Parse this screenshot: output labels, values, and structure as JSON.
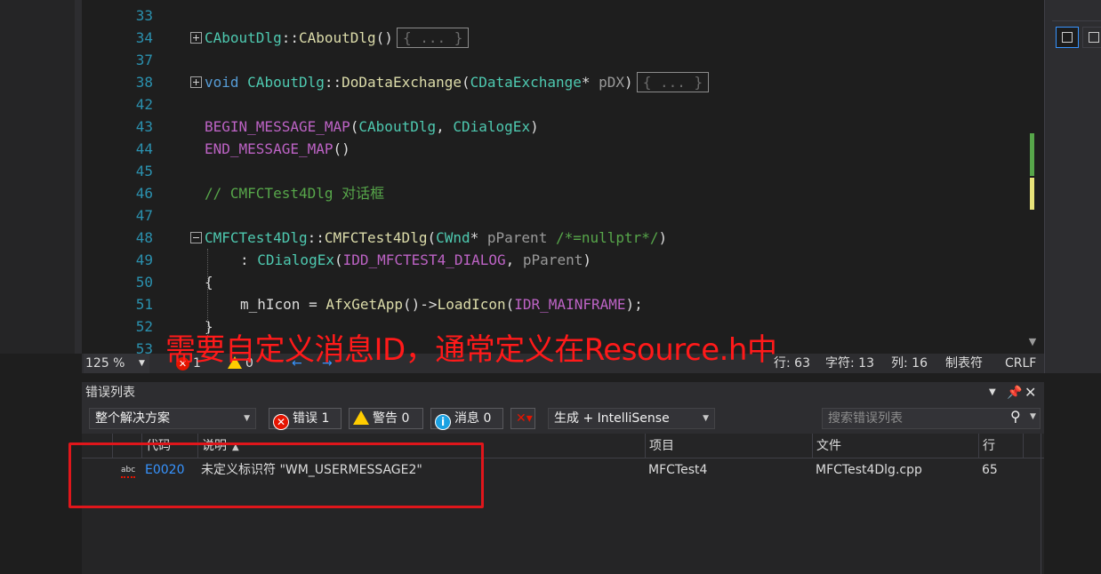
{
  "editor": {
    "lines": [
      {
        "n": "33"
      },
      {
        "n": "34",
        "fold": "plus",
        "parts": [
          [
            "ty",
            "CAboutDlg"
          ],
          [
            "pl",
            "::"
          ],
          [
            "fn",
            "CAboutDlg"
          ],
          [
            "pl",
            "()"
          ]
        ],
        "collapsed": "{ ... }"
      },
      {
        "n": "37"
      },
      {
        "n": "38",
        "fold": "plus",
        "parts": [
          [
            "kw",
            "void "
          ],
          [
            "ty",
            "CAboutDlg"
          ],
          [
            "pl",
            "::"
          ],
          [
            "fn",
            "DoDataExchange"
          ],
          [
            "pl",
            "("
          ],
          [
            "ty",
            "CDataExchange"
          ],
          [
            "pl",
            "* "
          ],
          [
            "pa",
            "pDX"
          ],
          [
            "pl",
            ")"
          ]
        ],
        "collapsed": "{ ... }"
      },
      {
        "n": "42"
      },
      {
        "n": "43",
        "parts": [
          [
            "mac",
            "BEGIN_MESSAGE_MAP"
          ],
          [
            "pl",
            "("
          ],
          [
            "ty",
            "CAboutDlg"
          ],
          [
            "pl",
            ", "
          ],
          [
            "ty",
            "CDialogEx"
          ],
          [
            "pl",
            ")"
          ]
        ]
      },
      {
        "n": "44",
        "parts": [
          [
            "mac",
            "END_MESSAGE_MAP"
          ],
          [
            "pl",
            "()"
          ]
        ]
      },
      {
        "n": "45"
      },
      {
        "n": "46",
        "parts": [
          [
            "cm",
            "// CMFCTest4Dlg 对话框"
          ]
        ]
      },
      {
        "n": "47"
      },
      {
        "n": "48",
        "fold": "minus",
        "parts": [
          [
            "ty",
            "CMFCTest4Dlg"
          ],
          [
            "pl",
            "::"
          ],
          [
            "fn",
            "CMFCTest4Dlg"
          ],
          [
            "pl",
            "("
          ],
          [
            "ty",
            "CWnd"
          ],
          [
            "pl",
            "* "
          ],
          [
            "pa",
            "pParent "
          ],
          [
            "cm",
            "/*=nullptr*/"
          ],
          [
            "pl",
            ")"
          ]
        ]
      },
      {
        "n": "49",
        "indent": 2,
        "parts": [
          [
            "pl",
            ": "
          ],
          [
            "ty",
            "CDialogEx"
          ],
          [
            "pl",
            "("
          ],
          [
            "mac",
            "IDD_MFCTEST4_DIALOG"
          ],
          [
            "pl",
            ", "
          ],
          [
            "pa",
            "pParent"
          ],
          [
            "pl",
            ")"
          ]
        ]
      },
      {
        "n": "50",
        "parts": [
          [
            "pl",
            "{"
          ]
        ]
      },
      {
        "n": "51",
        "indent": 2,
        "parts": [
          [
            "pl",
            "m_hIcon = "
          ],
          [
            "fn",
            "AfxGetApp"
          ],
          [
            "pl",
            "()->"
          ],
          [
            "fn",
            "LoadIcon"
          ],
          [
            "pl",
            "("
          ],
          [
            "mac",
            "IDR_MAINFRAME"
          ],
          [
            "pl",
            ");"
          ]
        ]
      },
      {
        "n": "52",
        "parts": [
          [
            "pl",
            "}"
          ]
        ]
      },
      {
        "n": "53"
      }
    ]
  },
  "annotation": "需要自定义消息ID，通常定义在Resource.h中",
  "status": {
    "zoom": "125 %",
    "errors": "1",
    "warnings": "0",
    "line": "行: 63",
    "char": "字符: 13",
    "col": "列: 16",
    "tab": "制表符",
    "eol": "CRLF"
  },
  "error_list": {
    "title": "错误列表",
    "scope": "整个解决方案",
    "errors_btn": "错误 1",
    "warnings_btn": "警告 0",
    "messages_btn": "消息 0",
    "build_source": "生成 + IntelliSense",
    "search_placeholder": "搜索错误列表",
    "columns": {
      "code": "代码",
      "desc": "说明",
      "project": "项目",
      "file": "文件",
      "line": "行"
    },
    "rows": [
      {
        "icon_label": "abc",
        "code": "E0020",
        "desc": "未定义标识符 \"WM_USERMESSAGE2\"",
        "project": "MFCTest4",
        "file": "MFCTest4Dlg.cpp",
        "line": "65"
      }
    ]
  },
  "colors": {
    "annotation": "#ff1a1a",
    "accent": "#3794ff",
    "error": "#e51400",
    "warning": "#ffcc00"
  }
}
